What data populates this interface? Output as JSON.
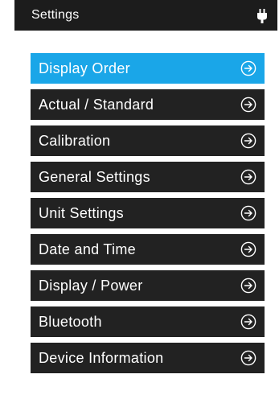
{
  "header": {
    "title": "Settings",
    "icon": "plug-icon"
  },
  "colors": {
    "active": "#1aa6e8",
    "item": "#222222",
    "header": "#1c1c1c",
    "text": "#ffffff"
  },
  "menu": {
    "items": [
      {
        "label": "Display Order",
        "active": true
      },
      {
        "label": "Actual / Standard",
        "active": false
      },
      {
        "label": "Calibration",
        "active": false
      },
      {
        "label": "General Settings",
        "active": false
      },
      {
        "label": "Unit Settings",
        "active": false
      },
      {
        "label": "Date and Time",
        "active": false
      },
      {
        "label": "Display / Power",
        "active": false
      },
      {
        "label": "Bluetooth",
        "active": false
      },
      {
        "label": "Device Information",
        "active": false
      }
    ]
  }
}
